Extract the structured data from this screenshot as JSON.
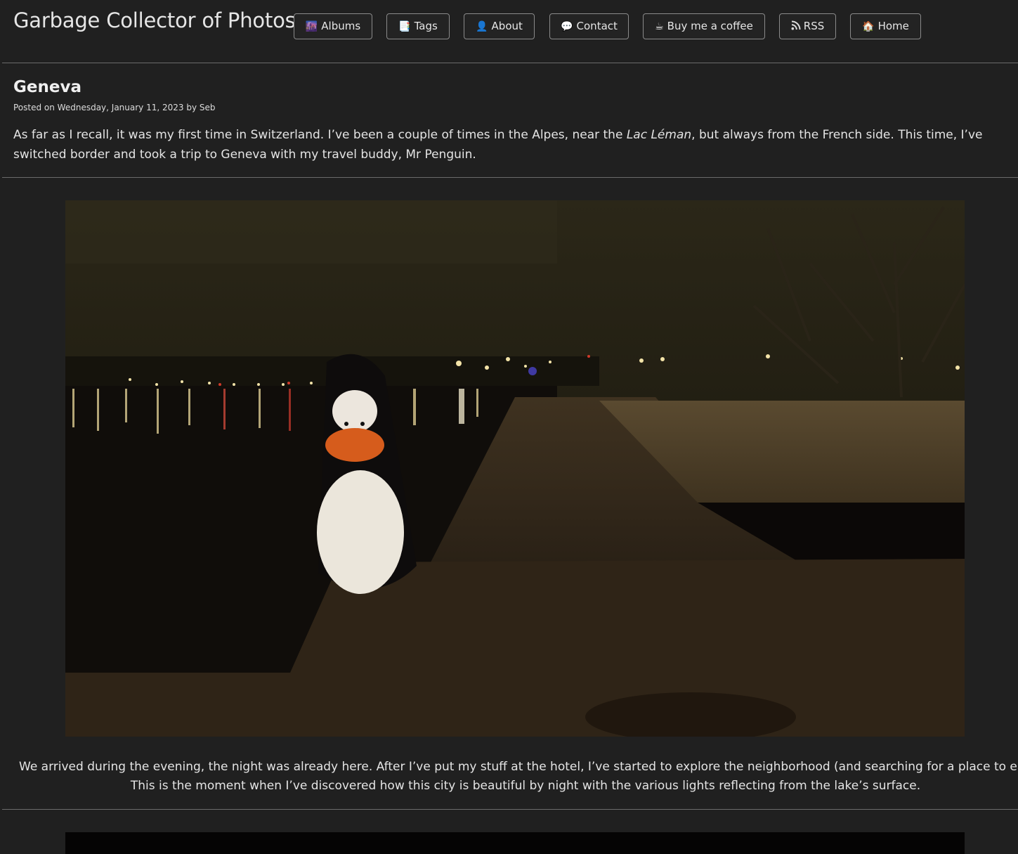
{
  "site": {
    "title": "Garbage Collector of Photos"
  },
  "nav": [
    {
      "icon": "🌆",
      "label": "Albums"
    },
    {
      "icon": "📑",
      "label": "Tags"
    },
    {
      "icon": "👤",
      "label": "About"
    },
    {
      "icon": "💬",
      "label": "Contact"
    },
    {
      "icon": "☕",
      "label": "Buy me a coffee"
    },
    {
      "icon": "rss-icon",
      "label": "RSS"
    },
    {
      "icon": "🏠",
      "label": "Home"
    }
  ],
  "post": {
    "title": "Geneva",
    "meta": "Posted on Wednesday, January 11, 2023 by Seb",
    "intro_before": "As far as I recall, it was my first time in Switzerland. I’ve been a couple of times in the Alpes, near the ",
    "intro_em": "Lac Léman",
    "intro_after": ", but always from the French side. This time, I’ve switched border and took a trip to Geneva with my travel buddy, Mr Penguin.",
    "caption_line1": "We arrived during the evening, the night was already here. After I’ve put my stuff at the hotel, I’ve started to explore the neighborhood (and searching for a place to eat BTW).",
    "caption_line2": "This is the moment when I’ve discovered how this city is beautiful by night with the various lights reflecting from the lake’s surface."
  }
}
